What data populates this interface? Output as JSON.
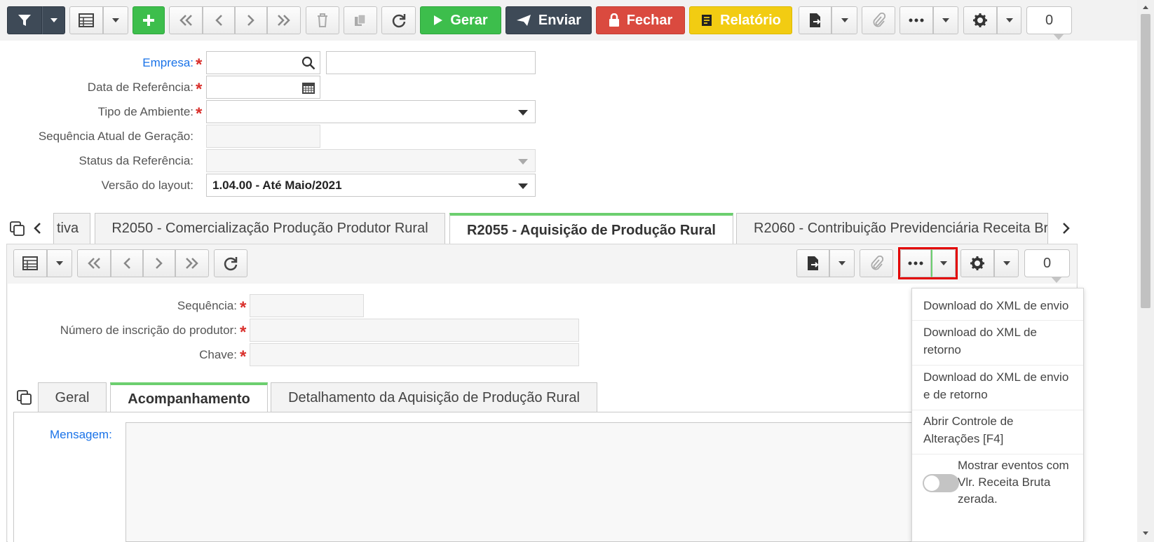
{
  "toolbar": {
    "gerar_label": "Gerar",
    "enviar_label": "Enviar",
    "fechar_label": "Fechar",
    "relatorio_label": "Relatório",
    "counter": "0"
  },
  "form": {
    "empresa_label": "Empresa:",
    "data_referencia_label": "Data de Referência:",
    "tipo_ambiente_label": "Tipo de Ambiente:",
    "sequencia_atual_label": "Sequência Atual de Geração:",
    "status_referencia_label": "Status da Referência:",
    "versao_layout_label": "Versão do layout:",
    "versao_layout_value": "1.04.00 - Até Maio/2021"
  },
  "tabs": {
    "tab_prev_partial": "tiva",
    "tab_r2050": "R2050 - Comercialização Produção Produtor Rural",
    "tab_r2055": "R2055 - Aquisição de Produção Rural",
    "tab_r2060": "R2060 - Contribuição Previdenciária Receita Br"
  },
  "subtoolbar": {
    "counter": "0"
  },
  "subform": {
    "sequencia_label": "Sequência:",
    "numero_inscricao_label": "Número de inscrição do produtor:",
    "chave_label": "Chave:"
  },
  "innertabs": {
    "geral": "Geral",
    "acompanhamento": "Acompanhamento",
    "detalhamento": "Detalhamento da Aquisição de Produção Rural"
  },
  "acompanhamento": {
    "mensagem_label": "Mensagem:"
  },
  "dropdown_menu": {
    "item1": "Download do XML de envio",
    "item2": "Download do XML de retorno",
    "item3": "Download do XML de envio e de retorno",
    "item4": "Abrir Controle de Alterações [F4]",
    "toggle_label": "Mostrar eventos com Vlr. Receita Bruta zerada."
  },
  "colors": {
    "green": "#3dbe4c",
    "dark": "#3e4a57",
    "red": "#da4a3f",
    "yellow": "#f2cc12",
    "link": "#1a73e8",
    "highlight": "#e30000"
  }
}
